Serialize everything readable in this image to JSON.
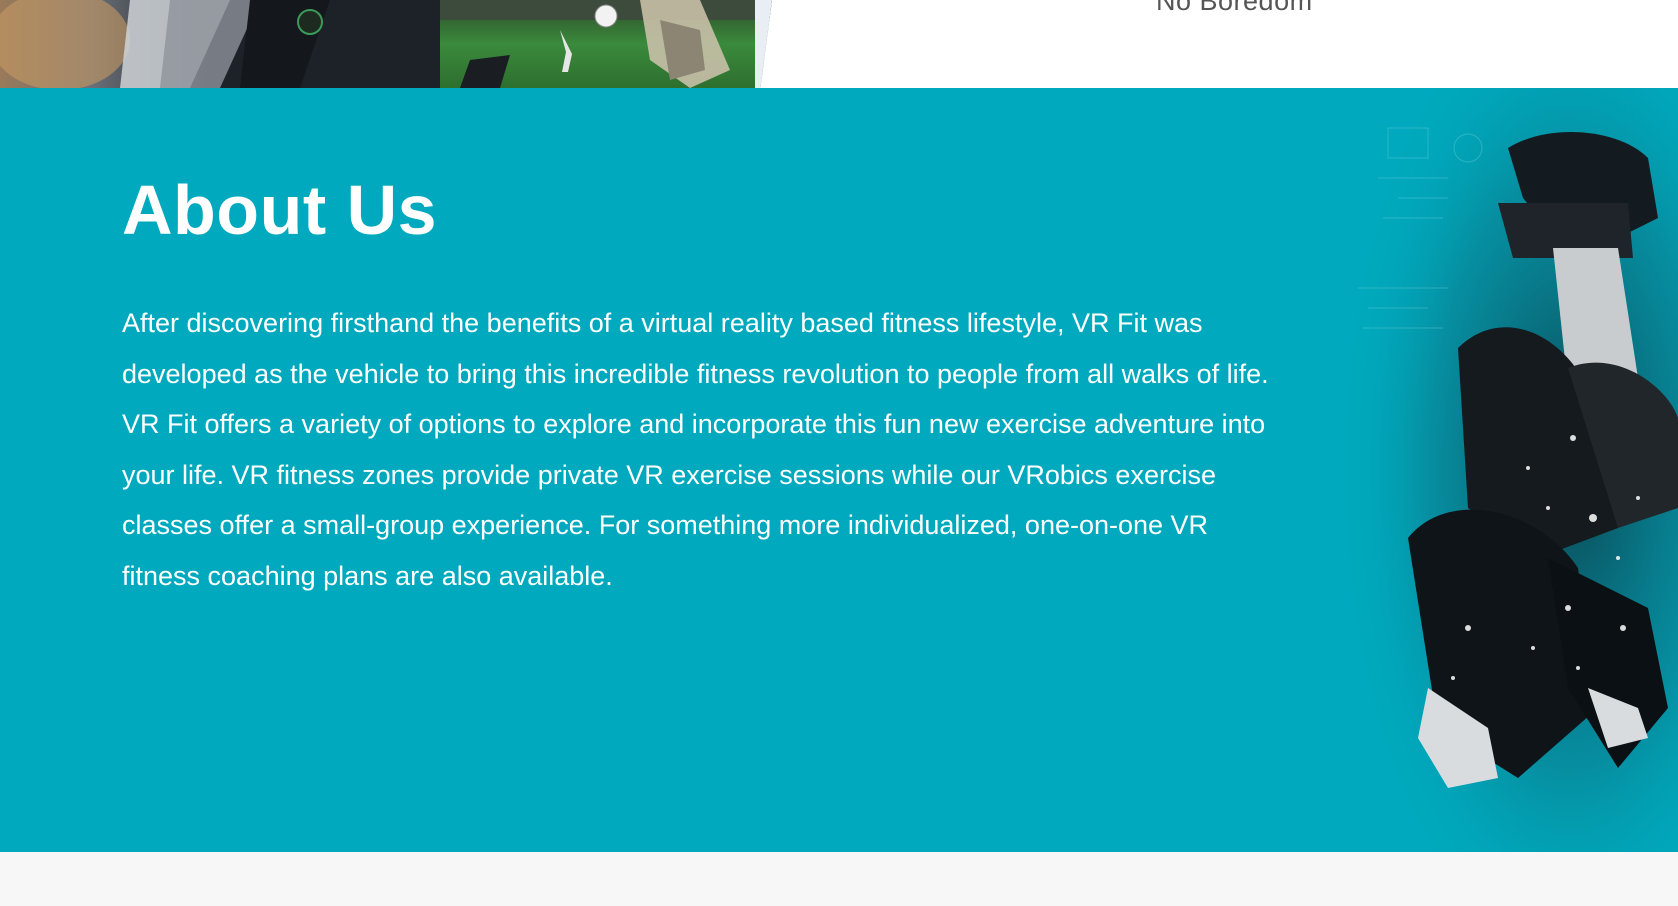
{
  "top": {
    "caption": "No Boredom",
    "banner_image_alt": "VR headset and soccer game collage"
  },
  "about": {
    "title": "About Us",
    "body": "After discovering firsthand the benefits of a virtual reality based fitness lifestyle, VR Fit was developed as the vehicle to bring this incredible fitness revolution to people from all walks of life. VR Fit offers a variety of options to explore and incorporate this fun new exercise adventure into your life. VR fitness zones provide private VR exercise sessions while our VRobics exercise classes offer a small-group experience. For something more individualized, one-on-one VR fitness coaching plans are also available.",
    "figure_alt": "Person wearing VR headset crouching"
  },
  "colors": {
    "section_background": "#00a9bd",
    "caption_text": "#555555",
    "footer_background": "#f7f7f7"
  }
}
